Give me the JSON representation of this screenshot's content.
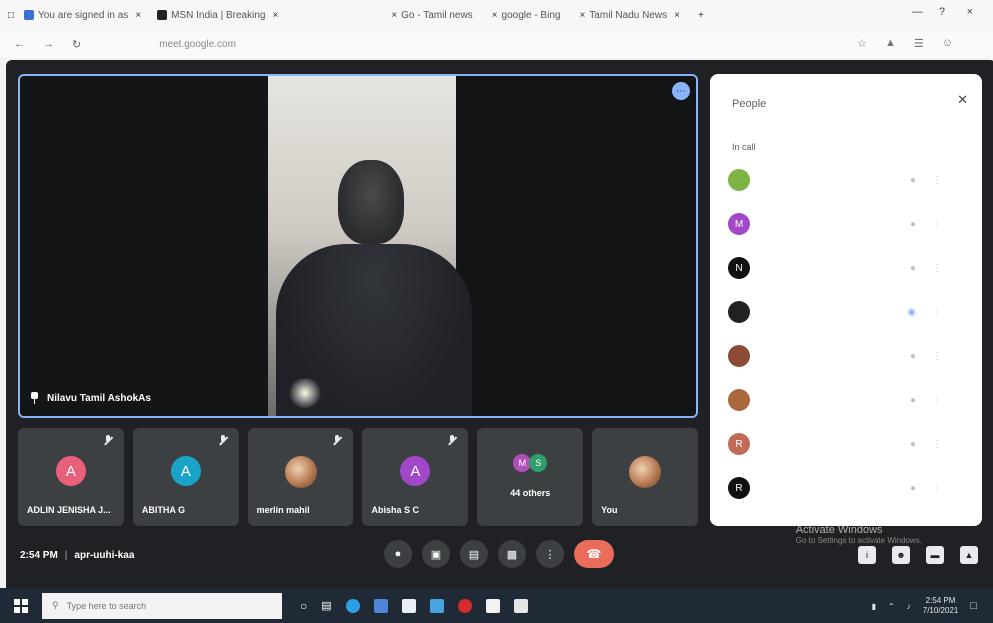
{
  "browser": {
    "tabs": [
      {
        "title": "You are signed in as",
        "favicon": "meet"
      },
      {
        "title": "MSN India | Breaking",
        "favicon": "msn"
      },
      {
        "title": "",
        "favicon": ""
      },
      {
        "title": "Go - Tamil news",
        "favicon": ""
      },
      {
        "title": "google - Bing",
        "favicon": ""
      },
      {
        "title": "Tamil Nadu News",
        "favicon": ""
      }
    ],
    "url": "meet.google.com"
  },
  "meeting": {
    "main_speaker": "Nilavu Tamil AshokAs",
    "time": "2:54 PM",
    "code": "apr-uuhi-kaa",
    "activate_title": "Activate Windows",
    "activate_sub": "Go to Settings to activate Windows."
  },
  "tiles": [
    {
      "name": "ADLIN JENISHA J...",
      "initial": "A",
      "color": "#e8607a",
      "muted": true,
      "type": "initial"
    },
    {
      "name": "ABITHA G",
      "initial": "A",
      "color": "#1aa3c8",
      "muted": true,
      "type": "initial"
    },
    {
      "name": "merlin mahil",
      "initial": "",
      "color": "",
      "muted": true,
      "type": "photo"
    },
    {
      "name": "Abisha S C",
      "initial": "A",
      "color": "#a048c8",
      "muted": true,
      "type": "initial"
    },
    {
      "name": "44 others",
      "initial": "",
      "color": "",
      "muted": false,
      "type": "others"
    },
    {
      "name": "You",
      "initial": "",
      "color": "",
      "muted": false,
      "type": "photo"
    }
  ],
  "others_avatars": [
    {
      "initial": "M",
      "color": "#b34fb8"
    },
    {
      "initial": "S",
      "color": "#2e9e6b"
    }
  ],
  "people_panel": {
    "title": "People",
    "section": "In call",
    "people": [
      {
        "initial": "",
        "color": "#7cb342",
        "name": ""
      },
      {
        "initial": "M",
        "color": "#a048c8",
        "name": ""
      },
      {
        "initial": "N",
        "color": "#111111",
        "name": ""
      },
      {
        "initial": "",
        "color": "#222222",
        "name": ""
      },
      {
        "initial": "",
        "color": "#8a4a36",
        "name": ""
      },
      {
        "initial": "",
        "color": "#a8683c",
        "name": ""
      },
      {
        "initial": "R",
        "color": "#c06a58",
        "name": ""
      },
      {
        "initial": "R",
        "color": "#111111",
        "name": ""
      }
    ]
  },
  "controls": {
    "mic": "mic-icon",
    "camera": "camera-icon",
    "captions": "captions-icon",
    "present": "present-icon",
    "more": "more-icon",
    "end": "end-call-icon"
  },
  "taskbar": {
    "search_placeholder": "Type here to search",
    "clock_time": "2:54 PM",
    "clock_date": "7/10/2021"
  }
}
